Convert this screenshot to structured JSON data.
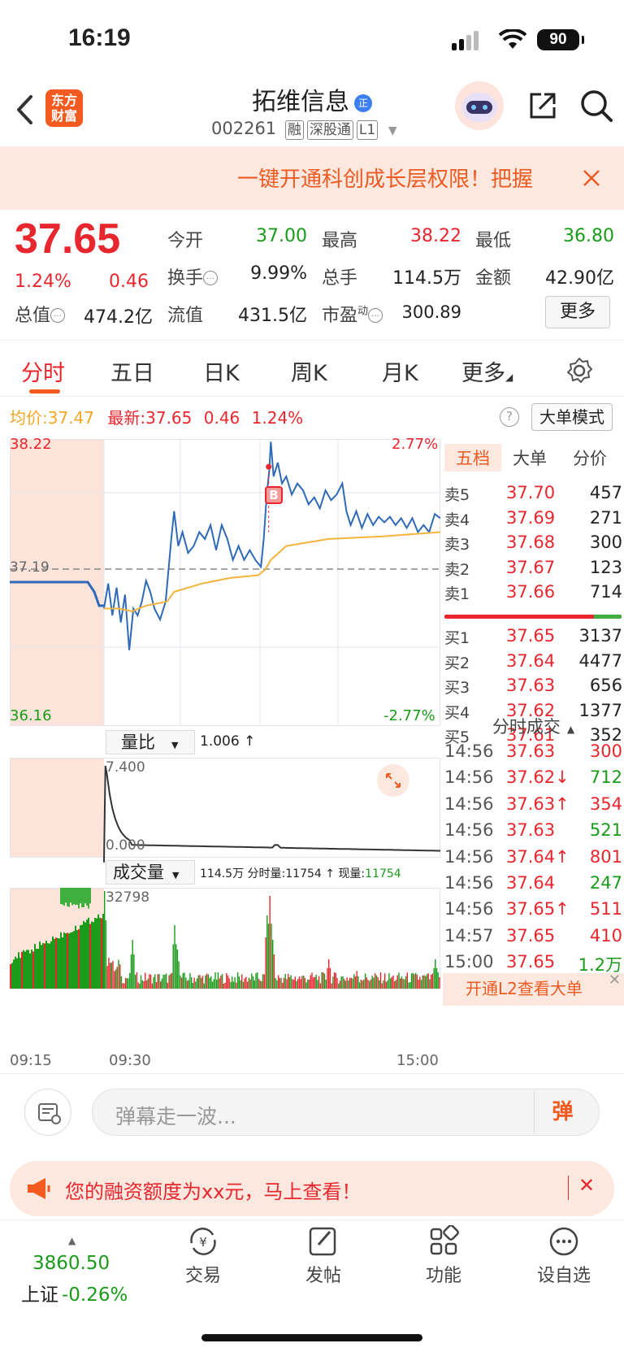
{
  "status_bar": {
    "time": "16:19",
    "battery": "90"
  },
  "header": {
    "logo_line1": "东方",
    "logo_line2": "财富",
    "stock_name": "拓维信息",
    "qi_badge": "正",
    "stock_code": "002261",
    "tags": [
      "融",
      "深股通",
      "L1"
    ]
  },
  "banner": {
    "text": "一键开通科创成长层权限！把握"
  },
  "quote": {
    "price": "37.65",
    "change_pct": "1.24%",
    "change": "0.46",
    "open_label": "今开",
    "open": "37.00",
    "high_label": "最高",
    "high": "38.22",
    "low_label": "最低",
    "low": "36.80",
    "turnover_label": "换手",
    "turnover": "9.99%",
    "volume_label": "总手",
    "volume": "114.5万",
    "amount_label": "金额",
    "amount": "42.90亿",
    "mcap_label": "总值",
    "mcap": "474.2亿",
    "float_label": "流值",
    "float": "431.5亿",
    "pe_label": "市盈",
    "pe_sup": "动",
    "pe": "300.89",
    "more": "更多"
  },
  "tabs": [
    "分时",
    "五日",
    "日K",
    "周K",
    "月K",
    "更多"
  ],
  "price_line": {
    "avg_label": "均价:",
    "avg": "37.47",
    "last_label": "最新:",
    "last": "37.65",
    "chg": "0.46",
    "pct": "1.24%",
    "mode_button": "大单模式"
  },
  "chart_labels": {
    "y_top": "38.22",
    "y_mid": "37.19",
    "y_bottom": "36.16",
    "pct_top": "2.77%",
    "pct_bottom": "-2.77%",
    "buy_marker": "B",
    "ratio_selector": "量比",
    "ratio_value": "1.006 ↑",
    "ratio_top": "7.400",
    "ratio_bottom": "0.000",
    "vol_selector": "成交量",
    "vol_total": "114.5万",
    "vol_fen_label": "分时量:",
    "vol_fen": "11754 ↑",
    "vol_now_label": "现量:",
    "vol_now": "11754",
    "vol_max": "32798",
    "t_start": "09:15",
    "t_open": "09:30",
    "t_end": "15:00"
  },
  "order_book": {
    "tabs": [
      "五档",
      "大单",
      "分价"
    ],
    "asks": [
      {
        "label": "卖5",
        "price": "37.70",
        "vol": "457"
      },
      {
        "label": "卖4",
        "price": "37.69",
        "vol": "271"
      },
      {
        "label": "卖3",
        "price": "37.68",
        "vol": "300"
      },
      {
        "label": "卖2",
        "price": "37.67",
        "vol": "123"
      },
      {
        "label": "卖1",
        "price": "37.66",
        "vol": "714"
      }
    ],
    "bids": [
      {
        "label": "买1",
        "price": "37.65",
        "vol": "3137"
      },
      {
        "label": "买2",
        "price": "37.64",
        "vol": "4477"
      },
      {
        "label": "买3",
        "price": "37.63",
        "vol": "656"
      },
      {
        "label": "买4",
        "price": "37.62",
        "vol": "1377"
      },
      {
        "label": "买5",
        "price": "37.61",
        "vol": "352"
      }
    ],
    "trades_title": "分时成交",
    "trades": [
      {
        "time": "14:56",
        "price": "37.63",
        "vol": "300",
        "dir": "",
        "vc": "red"
      },
      {
        "time": "14:56",
        "price": "37.62",
        "vol": "712",
        "dir": "↓",
        "vc": "green"
      },
      {
        "time": "14:56",
        "price": "37.63",
        "vol": "354",
        "dir": "↑",
        "vc": "red"
      },
      {
        "time": "14:56",
        "price": "37.63",
        "vol": "521",
        "dir": "",
        "vc": "green"
      },
      {
        "time": "14:56",
        "price": "37.64",
        "vol": "801",
        "dir": "↑",
        "vc": "red"
      },
      {
        "time": "14:56",
        "price": "37.64",
        "vol": "247",
        "dir": "",
        "vc": "green"
      },
      {
        "time": "14:56",
        "price": "37.65",
        "vol": "511",
        "dir": "↑",
        "vc": "red"
      },
      {
        "time": "14:57",
        "price": "37.65",
        "vol": "410",
        "dir": "",
        "vc": "red"
      },
      {
        "time": "15:00",
        "price": "37.65",
        "vol": "1.2万",
        "dir": "",
        "vc": "green"
      }
    ],
    "l2_text": "开通L2查看大单"
  },
  "comment": {
    "placeholder": "弹幕走一波...",
    "danmu": "弹"
  },
  "promo": {
    "text": "您的融资额度为xx元，马上查看！"
  },
  "nav": {
    "index_value": "3860.50",
    "index_name": "上证",
    "index_pct": "-0.26%",
    "items": [
      "交易",
      "发帖",
      "功能",
      "设自选"
    ]
  },
  "colors": {
    "up": "#e8262d",
    "down": "#1a9b1a",
    "accent": "#f25a1f",
    "price_line": "#2e6ab8",
    "avg_line": "#f5b43c"
  }
}
